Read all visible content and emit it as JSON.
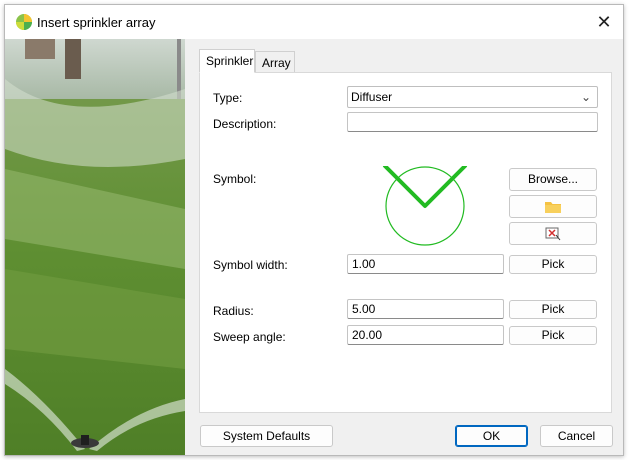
{
  "window": {
    "title": "Insert sprinkler array",
    "close_glyph": "✕"
  },
  "tabs": [
    {
      "label": "Sprinkler",
      "active": true
    },
    {
      "label": "Array",
      "active": false
    }
  ],
  "form": {
    "type_label": "Type:",
    "type_value": "Diffuser",
    "description_label": "Description:",
    "description_value": "",
    "symbol_label": "Symbol:",
    "symbol_width_label": "Symbol width:",
    "symbol_width_value": "1.00",
    "radius_label": "Radius:",
    "radius_value": "5.00",
    "sweep_angle_label": "Sweep angle:",
    "sweep_angle_value": "20.00"
  },
  "buttons": {
    "browse": "Browse...",
    "pick": "Pick",
    "system_defaults": "System Defaults",
    "ok": "OK",
    "cancel": "Cancel"
  },
  "icons": {
    "app": "sprinkler-app-icon",
    "folder": "folder-icon",
    "clear": "clear-symbol-icon",
    "chevron": "chevron-down-icon"
  },
  "colors": {
    "symbol_stroke": "#22bb22",
    "accent": "#0067c0",
    "folder": "#f5c243"
  }
}
